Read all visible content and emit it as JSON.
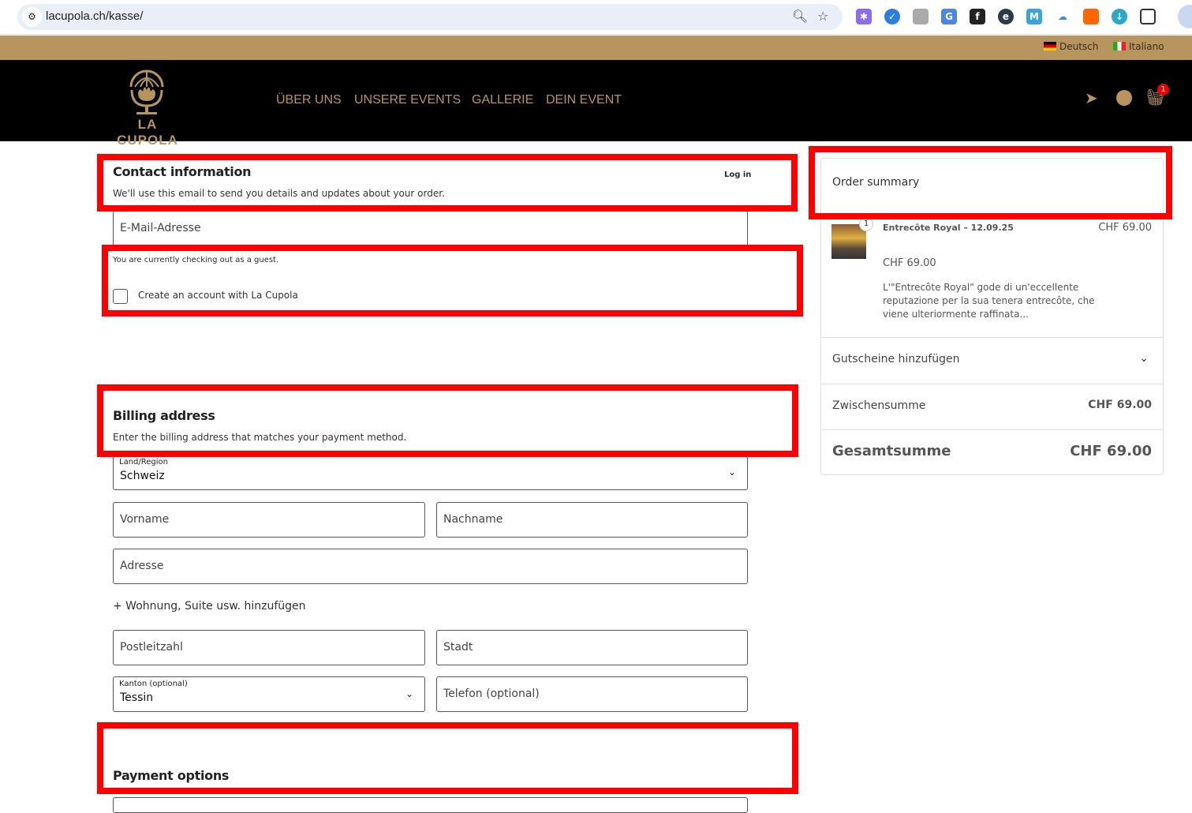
{
  "browser": {
    "url": "lacupola.ch/kasse/"
  },
  "languages": [
    {
      "label": "Deutsch"
    },
    {
      "label": "Italiano"
    }
  ],
  "brand": {
    "name": "LA CUPOLA",
    "accent": "#b8955f"
  },
  "nav": [
    {
      "label": "ÜBER UNS"
    },
    {
      "label": "UNSERE EVENTS"
    },
    {
      "label": "GALLERIE"
    },
    {
      "label": "DEIN EVENT"
    }
  ],
  "cart_count": "1",
  "contact": {
    "title": "Contact information",
    "login": "Log in",
    "subtitle": "We'll use this email to send you details and updates about your order.",
    "email_placeholder": "E-Mail-Adresse",
    "guest_note": "You are currently checking out as a guest.",
    "create_account": "Create an account with La Cupola"
  },
  "billing": {
    "title": "Billing address",
    "subtitle": "Enter the billing address that matches your payment method.",
    "country_label": "Land/Region",
    "country_value": "Schweiz",
    "first_name": "Vorname",
    "last_name": "Nachname",
    "address": "Adresse",
    "add_apartment": "+ Wohnung, Suite usw. hinzufügen",
    "postcode": "Postleitzahl",
    "city": "Stadt",
    "state_label": "Kanton (optional)",
    "state_value": "Tessin",
    "phone": "Telefon (optional)"
  },
  "payment": {
    "title": "Payment options"
  },
  "summary": {
    "title": "Order summary",
    "item": {
      "qty": "1",
      "name": "Entrecôte Royal – 12.09.25",
      "total": "CHF 69.00",
      "price": "CHF 69.00",
      "description": "L'\"Entrecôte Royal\" gode di un'eccellente reputazione per la sua tenera entrecôte, che viene ulteriormente raffinata..."
    },
    "coupons": "Gutscheine hinzufügen",
    "subtotal_label": "Zwischensumme",
    "subtotal": "CHF 69.00",
    "total_label": "Gesamtsumme",
    "total": "CHF 69.00"
  }
}
